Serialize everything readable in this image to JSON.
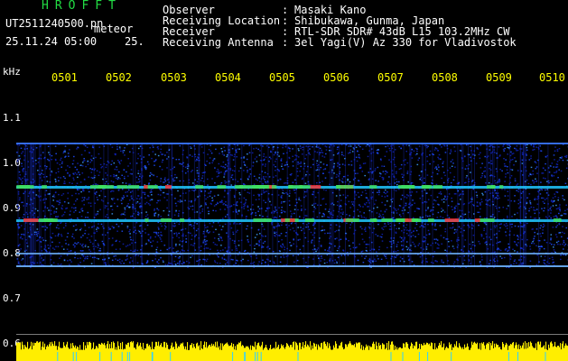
{
  "logo": "HROFFT",
  "file_name": "UT2511240500.pn",
  "mode_label": "meteor",
  "datetime": "25.11.24 05:00",
  "value_label": "25.",
  "header": [
    {
      "label": "Observer",
      "value": "Masaki Kano"
    },
    {
      "label": "Receiving Location",
      "value": "Shibukawa, Gunma, Japan"
    },
    {
      "label": "Receiver",
      "value": "RTL-SDR SDR# 43dB L15 103.2MHz CW"
    },
    {
      "label": "Receiving Antenna",
      "value": "3el Yagi(V) Az 330 for Vladivostok"
    }
  ],
  "header_colon": ":",
  "y_unit": "kHz",
  "y_ticks": [
    "1.1",
    "1.0",
    "0.9",
    "0.8",
    "0.7",
    "0.6"
  ],
  "x_ticks": [
    "0501",
    "0502",
    "0503",
    "0504",
    "0505",
    "0506",
    "0507",
    "0508",
    "0509",
    "0510"
  ],
  "colors": {
    "background": "#000000",
    "text_white": "#ffffff",
    "logo_green": "#22dd44",
    "axis_yellow": "#ffff00",
    "signal_blue": "#1a3cff",
    "signal_hot": "#ff2020"
  }
}
